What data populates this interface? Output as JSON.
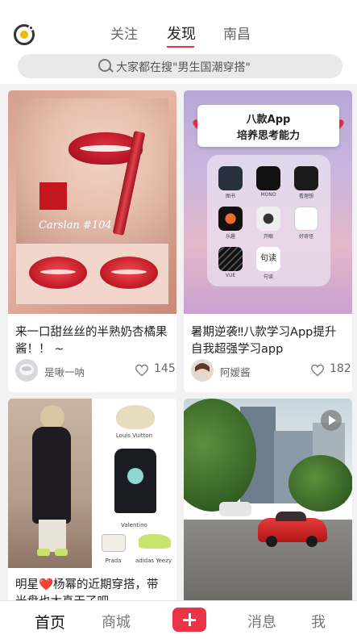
{
  "header": {
    "tabs": [
      {
        "label": "关注"
      },
      {
        "label": "发现"
      },
      {
        "label": "南昌"
      }
    ],
    "active_tab": "发现",
    "search": {
      "placeholder": "大家都在搜\"男生国潮穿搭\""
    }
  },
  "feed": {
    "cards": [
      {
        "title": "来一口甜丝丝的半熟奶杏橘果酱！！ ~",
        "author": "是啾一呐",
        "likes": "145",
        "image": {
          "overlay_text": "Carslan #104"
        }
      },
      {
        "title": "暑期逆袭‼八款学习App提升自我超强学习app",
        "author": "阿嫒酱",
        "likes": "182",
        "image": {
          "banner_line1": "八款App",
          "banner_line2": "培养思考能力",
          "apps": [
            "图书",
            "MONO",
            "看理想",
            "乐趣",
            "开眼",
            "好奇怪",
            "VUE",
            "句读"
          ],
          "center_app_text": "句读"
        }
      },
      {
        "title": "明星❤️杨幂的近期穿搭，带光盘也太真天了吧",
        "author": "",
        "likes": "",
        "image": {
          "labels": [
            "Louis Vuitton",
            "Valentino",
            "Prada",
            "adidas Yeezy"
          ]
        }
      },
      {
        "title": "",
        "author": "",
        "likes": "",
        "image": {
          "is_video": true
        }
      }
    ]
  },
  "bottom_nav": {
    "items": [
      {
        "label": "首页"
      },
      {
        "label": "商城"
      },
      {
        "label": "消息"
      },
      {
        "label": "我"
      }
    ],
    "add_icon": "plus-icon"
  },
  "colors": {
    "accent": "#ec3448",
    "tab_underline": "#e8334a"
  }
}
